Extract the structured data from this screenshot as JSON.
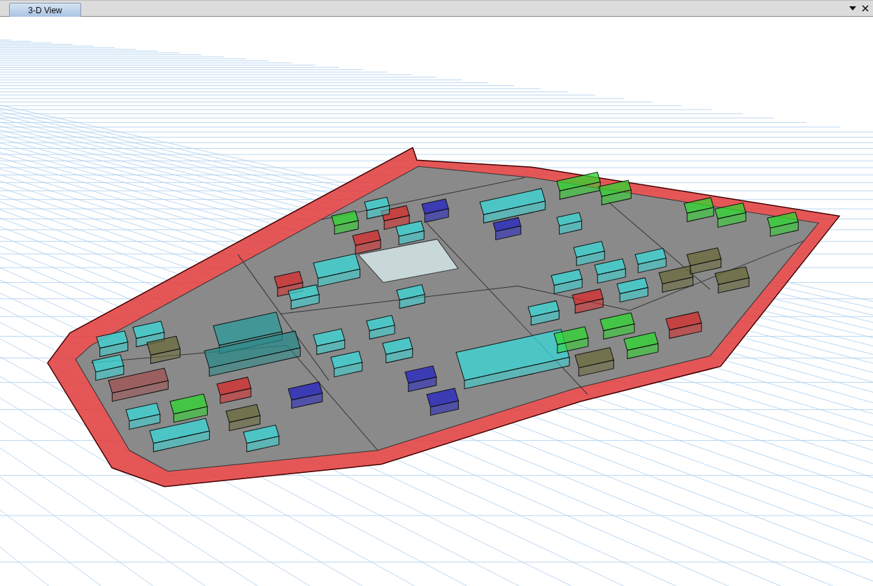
{
  "tabs": [
    {
      "label": "3-D View",
      "selected": true
    }
  ]
}
